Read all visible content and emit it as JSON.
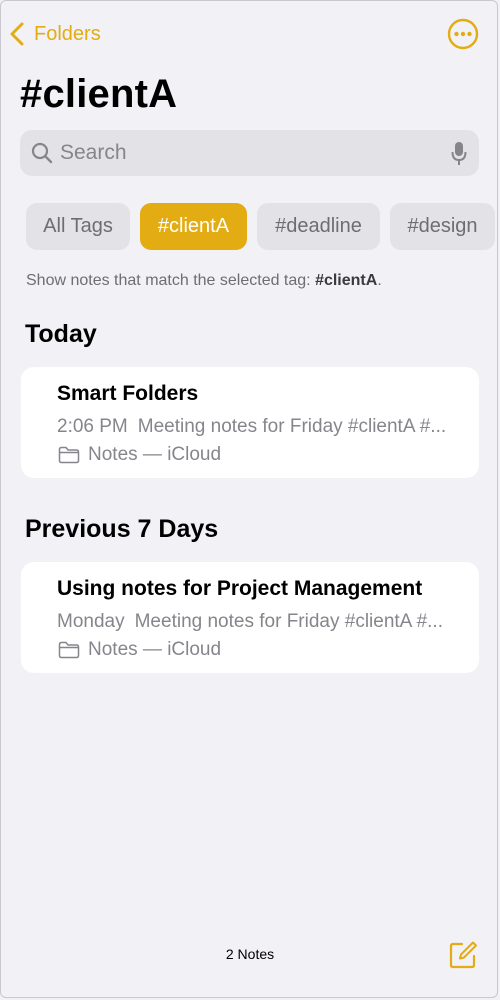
{
  "nav": {
    "back_label": "Folders",
    "back_icon": "chevron-left-icon",
    "more_icon": "ellipsis-circle-icon"
  },
  "page": {
    "title": "#clientA"
  },
  "search": {
    "placeholder": "Search",
    "value": "",
    "icon": "magnifying-glass-icon",
    "mic_icon": "microphone-icon"
  },
  "tags": [
    {
      "label": "All Tags",
      "selected": false
    },
    {
      "label": "#clientA",
      "selected": true
    },
    {
      "label": "#deadline",
      "selected": false
    },
    {
      "label": "#design",
      "selected": false
    }
  ],
  "hint": {
    "prefix": "Show notes that match the selected tag: ",
    "tag": "#clientA",
    "suffix": "."
  },
  "sections": [
    {
      "title": "Today",
      "notes": [
        {
          "title": "Smart Folders",
          "time": "2:06 PM",
          "preview": "Meeting notes for Friday #clientA #...",
          "folder": "Notes — iCloud"
        }
      ]
    },
    {
      "title": "Previous 7 Days",
      "notes": [
        {
          "title": "Using notes for Project Management",
          "time": "Monday",
          "preview": "Meeting notes for Friday #clientA #...",
          "folder": "Notes — iCloud"
        }
      ]
    }
  ],
  "footer": {
    "count": "2 Notes",
    "compose_icon": "compose-icon"
  },
  "colors": {
    "accent": "#e3ac12",
    "background": "#f2f1f6",
    "secondary_text": "#86858b"
  }
}
